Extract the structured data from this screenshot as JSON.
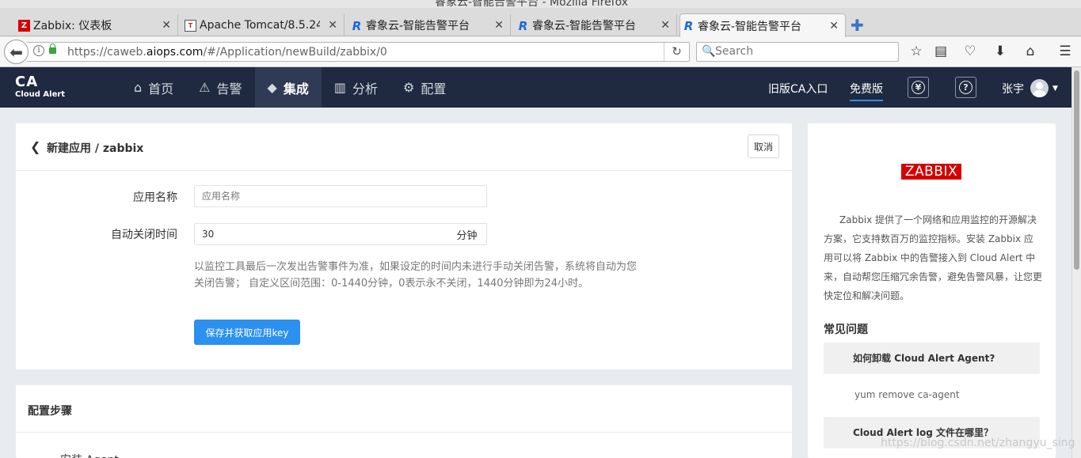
{
  "window": {
    "title": "睿象云-智能告警平台 - Mozilla Firefox"
  },
  "tabs": [
    {
      "label": "Zabbix: 仪表板",
      "favicon": "Z"
    },
    {
      "label": "Apache Tomcat/8.5.24",
      "favicon": "T"
    },
    {
      "label": "睿象云-智能告警平台",
      "favicon": "R"
    },
    {
      "label": "睿象云-智能告警平台",
      "favicon": "R"
    },
    {
      "label": "睿象云-智能告警平台",
      "favicon": "R"
    }
  ],
  "browser": {
    "url_prefix": "https://caweb.",
    "url_domain": "aiops.com",
    "url_path": "/#/Application/newBuild/zabbix/0",
    "search_placeholder": "Search"
  },
  "header": {
    "logo": "CA",
    "logo_sub": "Cloud Alert",
    "nav": [
      {
        "label": "首页",
        "icon": "home-icon"
      },
      {
        "label": "告警",
        "icon": "alarm-icon"
      },
      {
        "label": "集成",
        "icon": "layers-icon"
      },
      {
        "label": "分析",
        "icon": "chart-icon"
      },
      {
        "label": "配置",
        "icon": "gear-icon"
      }
    ],
    "old_entry": "旧版CA入口",
    "free_edition": "免费版",
    "user": "张宇"
  },
  "form": {
    "breadcrumb": "新建应用 / zabbix",
    "cancel": "取消",
    "app_name_label": "应用名称",
    "app_name_placeholder": "应用名称",
    "auto_close_label": "自动关闭时间",
    "auto_close_value": "30",
    "unit": "分钟",
    "help": "以监控工具最后一次发出告警事件为准，如果设定的时间内未进行手动关闭告警，系统将自动为您关闭告警； 自定义区间范围：0-1440分钟，0表示永不关闭，1440分钟即为24小时。",
    "save": "保存并获取应用key"
  },
  "steps": {
    "title": "配置步骤",
    "first": "安装 Agent"
  },
  "side": {
    "logo": "ZABBIX",
    "description": "Zabbix 提供了一个网络和应用监控的开源解决方案，它支持数百万的监控指标。安装 Zabbix 应用可以将 Zabbix 中的告警接入到 Cloud Alert 中来，自动帮您压缩冗余告警，避免告警风暴，让您更快定位和解决问题。",
    "faq_title": "常见问题",
    "faq": [
      {
        "q": "如何卸载 Cloud Alert Agent?",
        "a": "yum remove ca-agent"
      },
      {
        "q": "Cloud Alert log 文件在哪里？"
      }
    ]
  },
  "watermark": "https://blog.csdn.net/zhangyu_sing"
}
